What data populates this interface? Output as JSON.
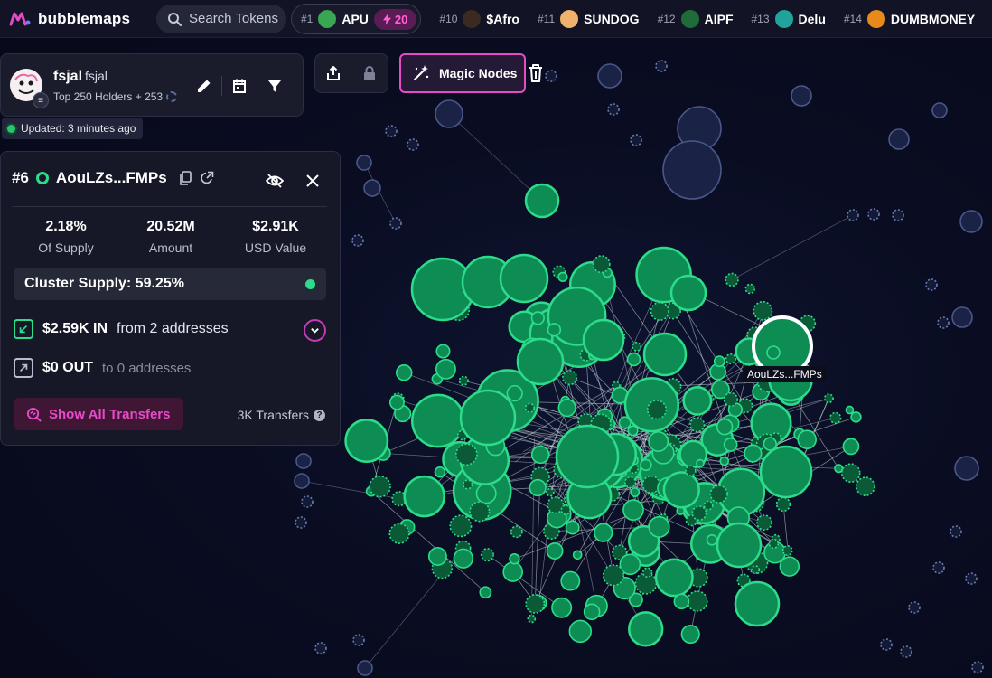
{
  "app": {
    "name": "bubblemaps"
  },
  "search": {
    "placeholder": "Search Tokens"
  },
  "ticker": [
    {
      "rank": "#1",
      "symbol": "APU",
      "boost": "20",
      "color": "#3aa552"
    },
    {
      "rank": "#10",
      "symbol": "$Afro",
      "color": "#3b2a1f"
    },
    {
      "rank": "#11",
      "symbol": "SUNDOG",
      "color": "#f0b16a"
    },
    {
      "rank": "#12",
      "symbol": "AIPF",
      "color": "#1f6b3a"
    },
    {
      "rank": "#13",
      "symbol": "Delu",
      "color": "#1fa39a"
    },
    {
      "rank": "#14",
      "symbol": "DUMBMONEY",
      "color": "#e88a1a"
    }
  ],
  "wallet": {
    "name": "fsjal",
    "sub": "fsjal",
    "meta": "Top 250 Holders + 253",
    "updated": "Updated: 3 minutes ago"
  },
  "magic_nodes": {
    "label": "Magic Nodes"
  },
  "holder": {
    "rank": "#6",
    "address": "AouLZs...FMPs",
    "stats": [
      {
        "value": "2.18%",
        "label": "Of Supply"
      },
      {
        "value": "20.52M",
        "label": "Amount"
      },
      {
        "value": "$2.91K",
        "label": "USD Value"
      }
    ],
    "cluster": "Cluster Supply: 59.25%",
    "in": {
      "amount": "$2.59K IN",
      "from": "from 2 addresses"
    },
    "out": {
      "amount": "$0 OUT",
      "to": "to 0 addresses"
    },
    "show_btn": "Show All Transfers",
    "transfers": "3K Transfers"
  },
  "graph": {
    "selected_label": "AouLZs...FMPs"
  },
  "colors": {
    "accent": "#e64ac6",
    "node_green": "#2ddc8a",
    "bg": "#0a0d22"
  }
}
